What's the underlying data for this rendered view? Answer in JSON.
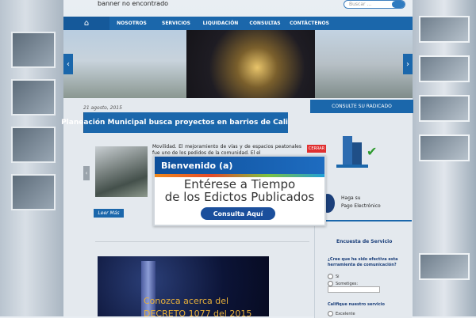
{
  "header": {
    "banner_missing": "banner no encontrado",
    "search_placeholder": "Buscar ..."
  },
  "nav": {
    "items": [
      {
        "label": "NOSOTROS"
      },
      {
        "label": "SERVICIOS"
      },
      {
        "label": "LIQUIDACIÓN"
      },
      {
        "label": "CONSULTAS"
      },
      {
        "label": "CONTÁCTENOS"
      }
    ]
  },
  "article": {
    "date": "21 agosto, 2015",
    "title": "Planeación Municipal busca proyectos en barrios de Cali",
    "excerpt": "Movilidad. El mejoramiento de vías y de espacios peatonales fue uno de los pedidos de la comunidad. El el",
    "read_more": "Leer Más"
  },
  "decree": {
    "line1": "Conozca acerca del",
    "line2": "DECRETO 1077 del 2015"
  },
  "sidebar": {
    "radicado_label": "CONSULTE SU RADICADO",
    "pago_line1": "Haga su",
    "pago_line2": "Pago Electrónico",
    "survey_title": "Encuesta de Servicio",
    "question1": "¿Cree que ha sido efectiva esta herramienta de comunicación?",
    "option_si": "Si",
    "option_sometimes": "Sometiges:",
    "question2": "Califique nuestro servicio",
    "option_excelente": "Excelente"
  },
  "popup": {
    "close_label": "CERRAR",
    "welcome": "Bienvenido (a)",
    "heading_line1": "Entérese a Tiempo",
    "heading_line2": "de los Edictos Publicados",
    "cta": "Consulta Aquí"
  },
  "colors": {
    "nav_blue": "#1b67ab",
    "close_red": "#e03030",
    "decree_gold": "#e8b03a"
  }
}
